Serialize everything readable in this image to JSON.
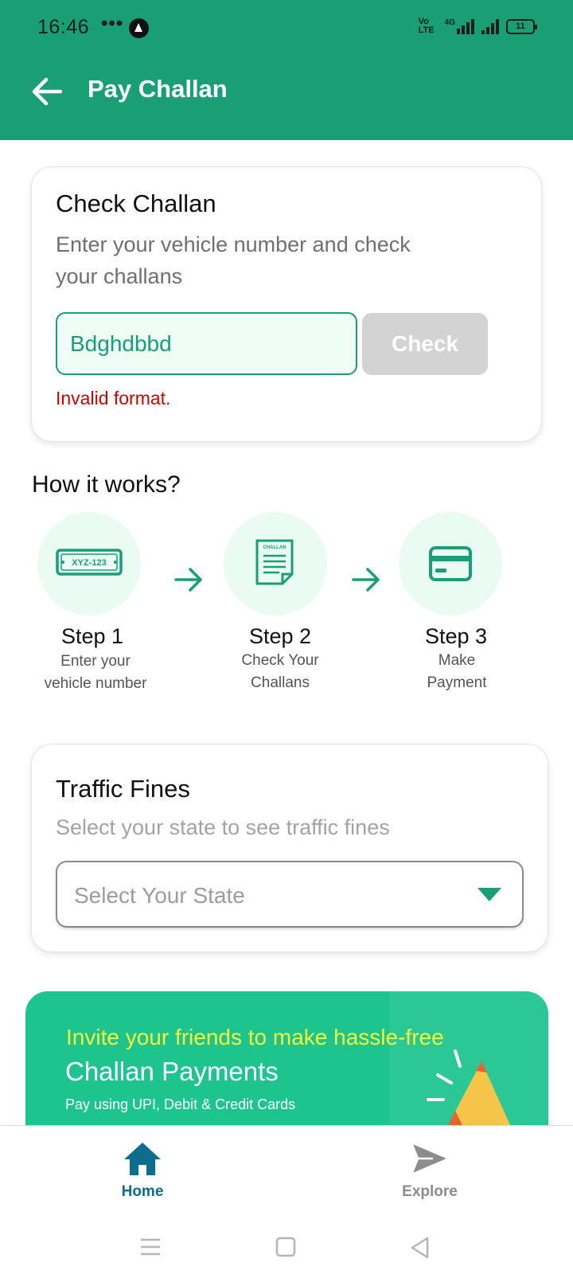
{
  "status_bar": {
    "time": "16:46",
    "dots": "•••",
    "battery": "11",
    "network": "4G",
    "volte": "Vo LTE"
  },
  "header": {
    "title": "Pay Challan",
    "back_icon": "arrow-left-icon"
  },
  "check_challan": {
    "title": "Check Challan",
    "subtitle": "Enter your vehicle number and check your challans",
    "input_value": "Bdghdbbd",
    "button_label": "Check",
    "error": "Invalid format."
  },
  "how_it_works": {
    "title": "How it works?",
    "plate_text": "XYZ-123",
    "doc_text": "CHALLAN",
    "steps": [
      {
        "title": "Step 1",
        "desc_line1": "Enter your",
        "desc_line2": "vehicle number",
        "icon": "license-plate-icon"
      },
      {
        "title": "Step 2",
        "desc_line1": "Check Your",
        "desc_line2": "Challans",
        "icon": "challan-document-icon"
      },
      {
        "title": "Step 3",
        "desc_line1": "Make",
        "desc_line2": "Payment",
        "icon": "card-icon"
      }
    ]
  },
  "traffic_fines": {
    "title": "Traffic Fines",
    "subtitle": "Select your state to see traffic fines",
    "select_placeholder": "Select Your State"
  },
  "promo": {
    "line1": "Invite your friends to make hassle-free",
    "line2": "Challan Payments",
    "line3": "Pay using UPI, Debit & Credit Cards"
  },
  "bottom_nav": {
    "items": [
      {
        "label": "Home",
        "icon": "home-icon",
        "active": true
      },
      {
        "label": "Explore",
        "icon": "send-icon",
        "active": false
      }
    ]
  },
  "colors": {
    "brand": "#1a9e74",
    "promo": "#1ec48e",
    "error": "#cc0000",
    "active_nav": "#0e6c8e"
  }
}
